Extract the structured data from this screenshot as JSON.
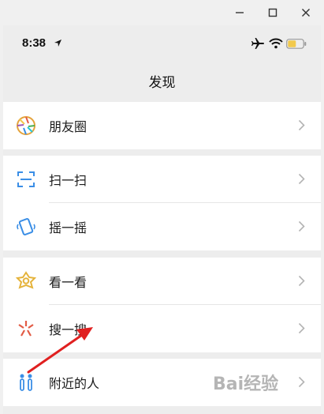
{
  "window_controls": {
    "minimize_icon": "minimize-icon",
    "maximize_icon": "maximize-icon",
    "close_icon": "close-icon"
  },
  "status_bar": {
    "time": "8:38",
    "battery_color": "#f2c94c"
  },
  "nav": {
    "title": "发现"
  },
  "menu": {
    "moments": "朋友圈",
    "scan": "扫一扫",
    "shake": "摇一摇",
    "top_stories": "看一看",
    "search": "搜一搜",
    "people_nearby": "附近的人"
  },
  "annotation": {
    "arrow_color": "#e02020"
  },
  "watermark": {
    "text": "Bai经验"
  }
}
